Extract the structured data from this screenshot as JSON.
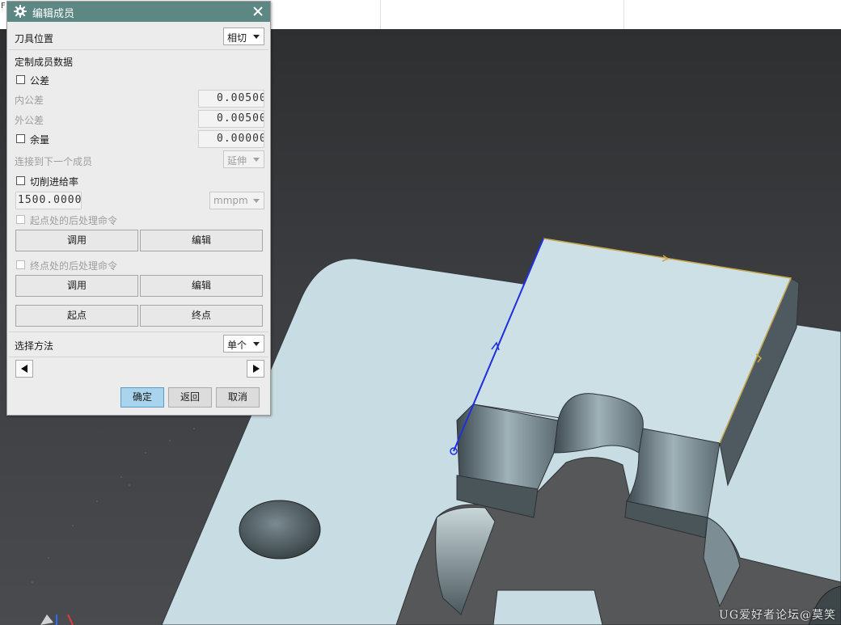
{
  "dialog": {
    "title": "编辑成员",
    "tool_position_label": "刀具位置",
    "tool_position_value": "相切",
    "custom_data_header": "定制成员数据",
    "tolerance_label": "公差",
    "inner_tolerance_label": "内公差",
    "inner_tolerance_value": "0.00500",
    "outer_tolerance_label": "外公差",
    "outer_tolerance_value": "0.00500",
    "stock_label": "余量",
    "stock_value": "0.00000",
    "connect_next_label": "连接到下一个成员",
    "connect_next_value": "延伸",
    "cut_feedrate_label": "切削进给率",
    "feedrate_value": "1500.0000",
    "feedrate_unit": "mmpm",
    "start_post_cmd_label": "起点处的后处理命令",
    "start_call_label": "调用",
    "start_edit_label": "编辑",
    "end_post_cmd_label": "终点处的后处理命令",
    "end_call_label": "调用",
    "end_edit_label": "编辑",
    "start_point_label": "起点",
    "end_point_label": "终点",
    "select_method_label": "选择方法",
    "select_method_value": "单个",
    "ok_label": "确定",
    "back_label": "返回",
    "cancel_label": "取消"
  },
  "watermark": "UG爱好者论坛@莫笑",
  "topstrip_fragment": "F"
}
